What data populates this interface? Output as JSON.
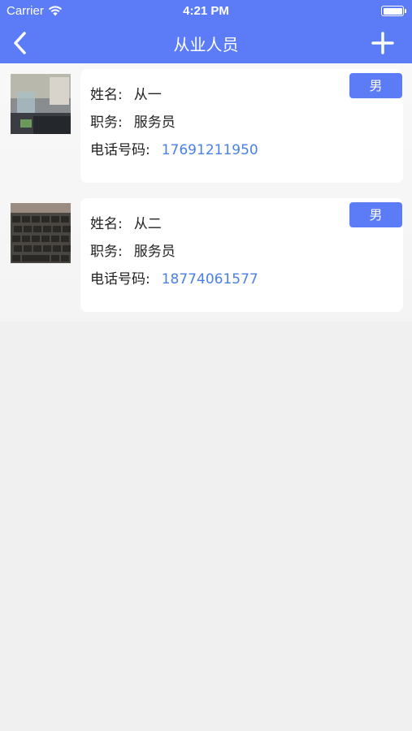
{
  "status_bar": {
    "carrier": "Carrier",
    "time": "4:21 PM"
  },
  "nav": {
    "title": "从业人员",
    "back_icon": "chevron-left-icon",
    "add_icon": "plus-icon"
  },
  "colors": {
    "accent": "#5b7cf6",
    "phone": "#4a80e8",
    "background": "#f0f0f0"
  },
  "staff": [
    {
      "name_label": "姓名:",
      "name": "从一",
      "role_label": "职务:",
      "role": "服务员",
      "phone_label": "电话号码:",
      "phone": "17691211950",
      "gender": "男"
    },
    {
      "name_label": "姓名:",
      "name": "从二",
      "role_label": "职务:",
      "role": "服务员",
      "phone_label": "电话号码:",
      "phone": "18774061577",
      "gender": "男"
    }
  ]
}
